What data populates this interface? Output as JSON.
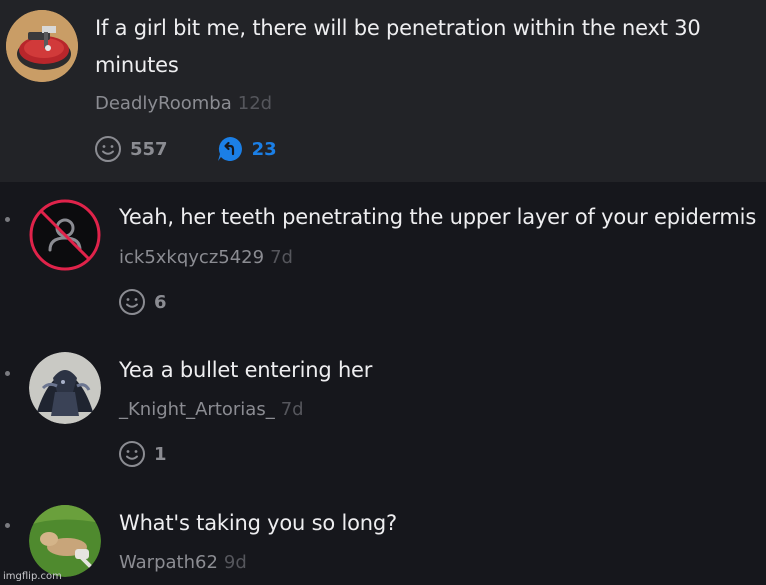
{
  "parent_comment": {
    "text": "If a girl bit me, there will be penetration within the next 30 minutes",
    "text_line1": "If a girl bit me, there will be penetration within the next 30",
    "text_line2": "minutes",
    "username": "DeadlyRoomba",
    "age": "12d",
    "upvotes": "557",
    "replies": "23",
    "avatar_icon": "roomba-avatar"
  },
  "replies": [
    {
      "text": "Yeah, her teeth penetrating the upper layer of your epidermis",
      "username": "ick5xkqycz5429",
      "age": "7d",
      "upvotes": "6",
      "avatar_icon": "no-user-avatar"
    },
    {
      "text": "Yea a bullet entering her",
      "username": "_Knight_Artorias_",
      "age": "7d",
      "upvotes": "1",
      "avatar_icon": "knight-avatar"
    },
    {
      "text": "What's taking you so long?",
      "username": "Warpath62",
      "age": "9d",
      "avatar_icon": "dog-avatar"
    }
  ],
  "watermark": "imgflip.com",
  "colors": {
    "parent_bg": "#222327",
    "page_bg": "#16171c",
    "reply_accent": "#1b7fe6",
    "ban_red": "#e0234a"
  }
}
